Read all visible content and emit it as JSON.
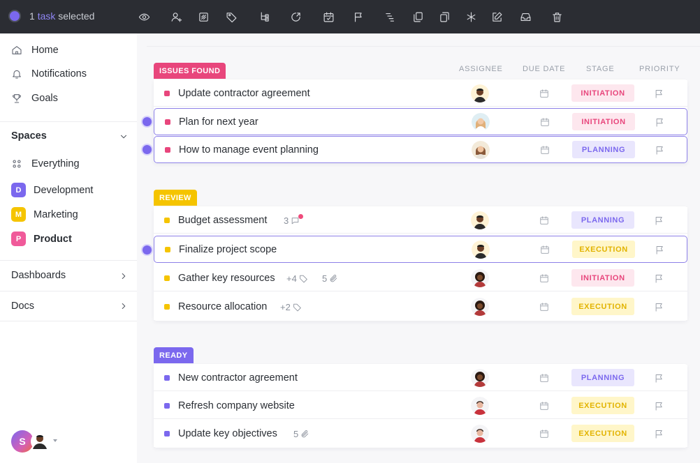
{
  "colors": {
    "accent": "#7b68ee",
    "issues": "#e8467c",
    "review": "#f5c400",
    "ready": "#7b68ee",
    "initiation_bg": "#fde7ee",
    "initiation_fg": "#e8467c",
    "planning_bg": "#e9e6fd",
    "planning_fg": "#7b68ee",
    "execution_bg": "#fff6c9",
    "execution_fg": "#e2b300"
  },
  "topbar": {
    "selected_count": "1",
    "selected_word": "task",
    "selected_suffix": "selected",
    "tools": [
      "eye-icon",
      "add-user-icon",
      "square-icon",
      "tag-icon",
      "subtask-icon",
      "move-icon",
      "calendar-icon",
      "flag-icon",
      "gantt-icon",
      "copy-icon",
      "duplicate-icon",
      "asterisk-icon",
      "edit-icon",
      "inbox-icon",
      "trash-icon"
    ]
  },
  "sidebar": {
    "nav": [
      {
        "label": "Home",
        "icon": "home-icon"
      },
      {
        "label": "Notifications",
        "icon": "bell-icon"
      },
      {
        "label": "Goals",
        "icon": "trophy-icon"
      }
    ],
    "spaces_title": "Spaces",
    "everything_label": "Everything",
    "spaces": [
      {
        "letter": "D",
        "label": "Development",
        "color": "#7b68ee"
      },
      {
        "letter": "M",
        "label": "Marketing",
        "color": "#f5c400"
      },
      {
        "letter": "P",
        "label": "Product",
        "color": "#f05a9a"
      }
    ],
    "dashboards_label": "Dashboards",
    "docs_label": "Docs",
    "avatar_letter": "S"
  },
  "columns": {
    "assignee": "ASSIGNEE",
    "due_date": "DUE DATE",
    "stage": "STAGE",
    "priority": "PRIORITY"
  },
  "groups": [
    {
      "label": "ISSUES FOUND",
      "tasks": [
        {
          "name": "Update contractor agreement",
          "stage": "INITIATION",
          "selected": false,
          "meta": ""
        },
        {
          "name": "Plan for next year",
          "stage": "INITIATION",
          "selected": true,
          "meta": ""
        },
        {
          "name": "How to manage event planning",
          "stage": "PLANNING",
          "selected": true,
          "meta": ""
        }
      ]
    },
    {
      "label": "REVIEW",
      "tasks": [
        {
          "name": "Budget assessment",
          "stage": "PLANNING",
          "selected": false,
          "meta": "3"
        },
        {
          "name": "Finalize project scope",
          "stage": "EXECUTION",
          "selected": true,
          "meta": ""
        },
        {
          "name": "Gather key resources",
          "stage": "INITIATION",
          "selected": false,
          "meta": "+4",
          "meta2": "5"
        },
        {
          "name": "Resource allocation",
          "stage": "EXECUTION",
          "selected": false,
          "meta": "+2"
        }
      ]
    },
    {
      "label": "READY",
      "tasks": [
        {
          "name": "New contractor agreement",
          "stage": "PLANNING",
          "selected": false,
          "meta": ""
        },
        {
          "name": "Refresh company website",
          "stage": "EXECUTION",
          "selected": false,
          "meta": ""
        },
        {
          "name": "Update key objectives",
          "stage": "EXECUTION",
          "selected": false,
          "meta": "5"
        }
      ]
    }
  ]
}
